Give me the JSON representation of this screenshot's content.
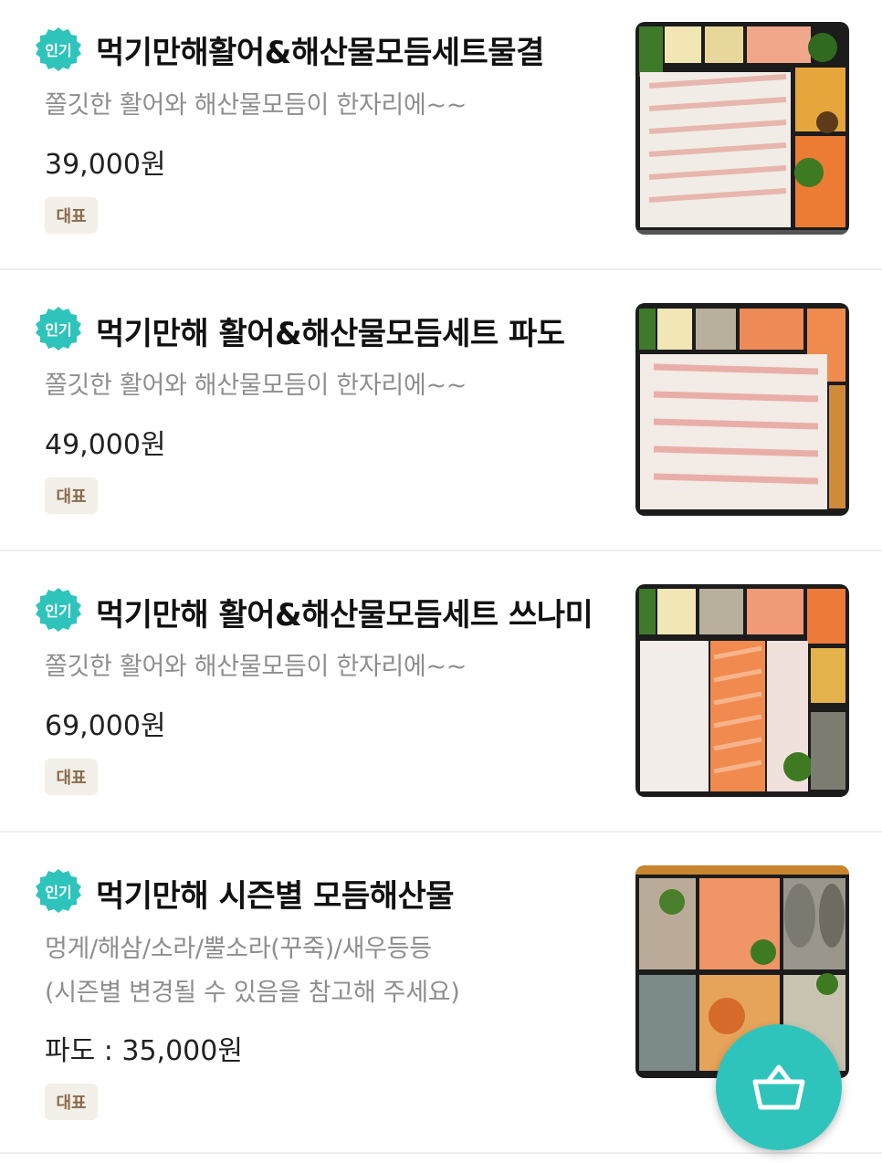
{
  "items": [
    {
      "popular_badge": "인기",
      "name": "먹기만해활어&해산물모듬세트물결",
      "description": [
        "쫄깃한 활어와 해산물모듬이 한자리에~~"
      ],
      "price": "39,000원",
      "rep_badge": "대표"
    },
    {
      "popular_badge": "인기",
      "name": "먹기만해 활어&해산물모듬세트 파도",
      "description": [
        "쫄깃한 활어와 해산물모듬이 한자리에~~"
      ],
      "price": "49,000원",
      "rep_badge": "대표"
    },
    {
      "popular_badge": "인기",
      "name": "먹기만해 활어&해산물모듬세트 쓰나미",
      "description": [
        "쫄깃한 활어와 해산물모듬이 한자리에~~"
      ],
      "price": "69,000원",
      "rep_badge": "대표"
    },
    {
      "popular_badge": "인기",
      "name": "먹기만해 시즌별 모듬해산물",
      "description": [
        "멍게/해삼/소라/뿔소라(꾸죽)/새우등등",
        "(시즌별 변경될 수 있음을 참고해 주세요)"
      ],
      "price": "파도 : 35,000원",
      "rep_badge": "대표"
    }
  ],
  "cart_button": {
    "icon": "basket-icon"
  },
  "colors": {
    "popular": "#2fc4bb",
    "cart": "#2fc4bb",
    "rep_bg": "#f3efe9",
    "rep_text": "#8a6a4a"
  }
}
